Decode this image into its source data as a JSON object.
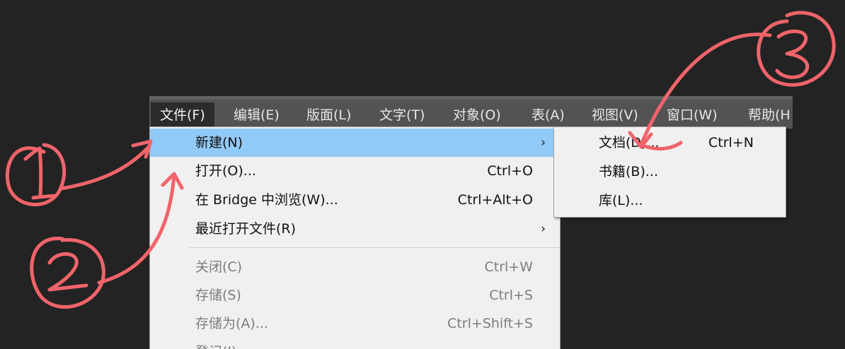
{
  "menubar": {
    "items": [
      {
        "label": "文件(F)"
      },
      {
        "label": "编辑(E)"
      },
      {
        "label": "版面(L)"
      },
      {
        "label": "文字(T)"
      },
      {
        "label": "对象(O)"
      },
      {
        "label": "表(A)"
      },
      {
        "label": "视图(V)"
      },
      {
        "label": "窗口(W)"
      },
      {
        "label": "帮助(H"
      }
    ]
  },
  "file_menu": {
    "items": [
      {
        "label": "新建(N)",
        "shortcut": "",
        "submenu_arrow": "›"
      },
      {
        "label": "打开(O)...",
        "shortcut": "Ctrl+O"
      },
      {
        "label": "在 Bridge 中浏览(W)...",
        "shortcut": "Ctrl+Alt+O"
      },
      {
        "label": "最近打开文件(R)",
        "shortcut": "",
        "submenu_arrow": "›"
      },
      {
        "label": "关闭(C)",
        "shortcut": "Ctrl+W"
      },
      {
        "label": "存储(S)",
        "shortcut": "Ctrl+S"
      },
      {
        "label": "存储为(A)...",
        "shortcut": "Ctrl+Shift+S"
      },
      {
        "label": "登记(I)",
        "shortcut": ""
      }
    ]
  },
  "new_submenu": {
    "items": [
      {
        "label": "文档(D)...",
        "shortcut": "Ctrl+N"
      },
      {
        "label": "书籍(B)...",
        "shortcut": ""
      },
      {
        "label": "库(L)...",
        "shortcut": ""
      }
    ]
  },
  "colors": {
    "background": "#232323",
    "menubar": "#535353",
    "highlight": "#91c9f7",
    "annotation": "#f0646a"
  }
}
